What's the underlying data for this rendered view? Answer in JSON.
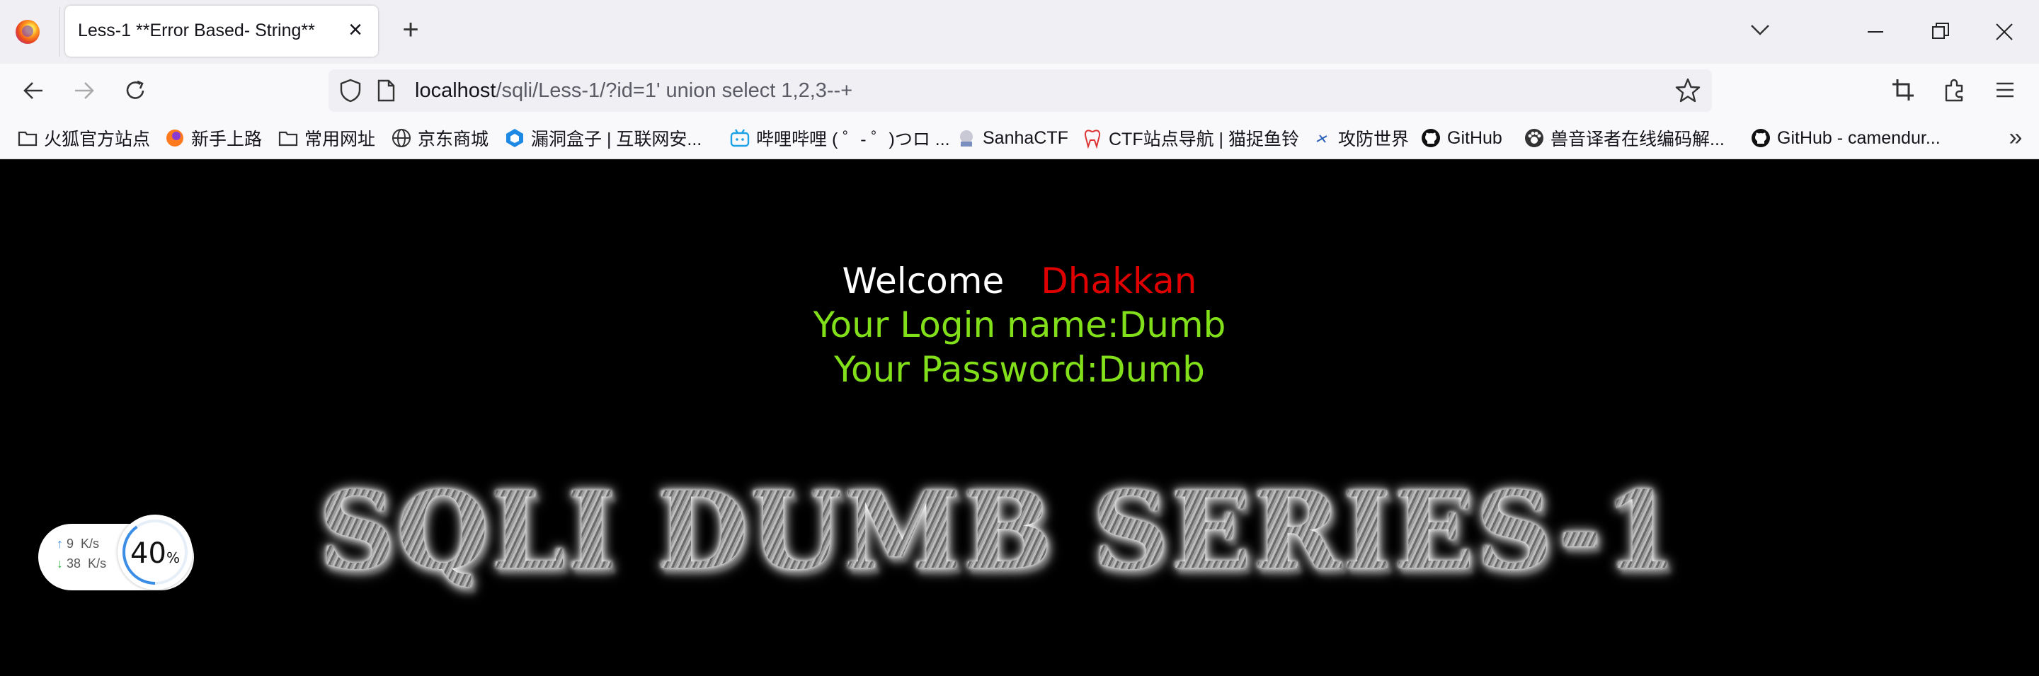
{
  "browser": {
    "tab": {
      "title": "Less-1 **Error Based- String**",
      "close": "×"
    },
    "new_tab": "+",
    "url": {
      "host": "localhost",
      "path": "/sqli/Less-1/?id=1' union select 1,2,3--+"
    },
    "bookmarks": [
      {
        "label": "火狐官方站点",
        "icon": "folder-icon"
      },
      {
        "label": "新手上路",
        "icon": "firefox-icon"
      },
      {
        "label": "常用网址",
        "icon": "folder-icon"
      },
      {
        "label": "京东商城",
        "icon": "globe-icon"
      },
      {
        "label": "漏洞盒子 | 互联网安...",
        "icon": "hexagon-icon"
      },
      {
        "label": "哔哩哔哩 ( ゜- ゜)つロ ...",
        "icon": "bilibili-icon"
      },
      {
        "label": "SanhaCTF",
        "icon": "sanha-icon"
      },
      {
        "label": "CTF站点导航 | 猫捉鱼铃",
        "icon": "tooth-icon"
      },
      {
        "label": "攻防世界",
        "icon": "xctf-icon"
      },
      {
        "label": "GitHub",
        "icon": "github-icon"
      },
      {
        "label": "兽音译者在线编码解...",
        "icon": "paw-icon"
      },
      {
        "label": "GitHub - camendur...",
        "icon": "github-icon"
      }
    ],
    "more_bookmarks": "»"
  },
  "page": {
    "welcome": "Welcome",
    "user": "Dhakkan",
    "login_name": "Your Login name:Dumb",
    "password": "Your Password:Dumb",
    "banner": "SQLI DUMB SERIES-1"
  },
  "net_widget": {
    "up_value": "9",
    "up_unit": "K/s",
    "down_value": "38",
    "down_unit": "K/s",
    "percent": "40",
    "percent_sign": "%",
    "progress": 0.4
  },
  "colors": {
    "welcome": "#ffffff",
    "user": "#e00000",
    "info": "#82e01a",
    "background": "#000000"
  }
}
